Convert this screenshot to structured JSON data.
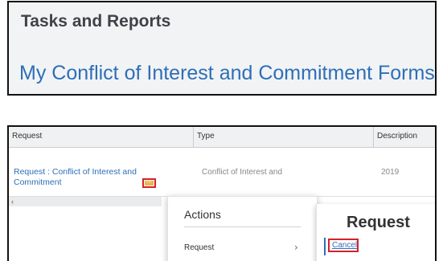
{
  "tasks_panel": {
    "title": "Tasks and Reports",
    "link": "My Conflict of Interest and Commitment Forms"
  },
  "table": {
    "columns": [
      "Request",
      "Type",
      "Description"
    ],
    "rows": [
      {
        "request": "Request : Conflict of Interest and Commitment",
        "type": "Conflict of Interest and",
        "description": "2019"
      }
    ],
    "scroll_arrow": "‹"
  },
  "actions_menu": {
    "title": "Actions",
    "items": [
      {
        "label": "Request",
        "chevron": "›"
      }
    ]
  },
  "submenu": {
    "title": "Request",
    "items": [
      "Cancel"
    ]
  },
  "colors": {
    "link": "#2d6fb7",
    "highlight_border": "#d3222a",
    "related_actions_icon": "#f1b24a"
  }
}
